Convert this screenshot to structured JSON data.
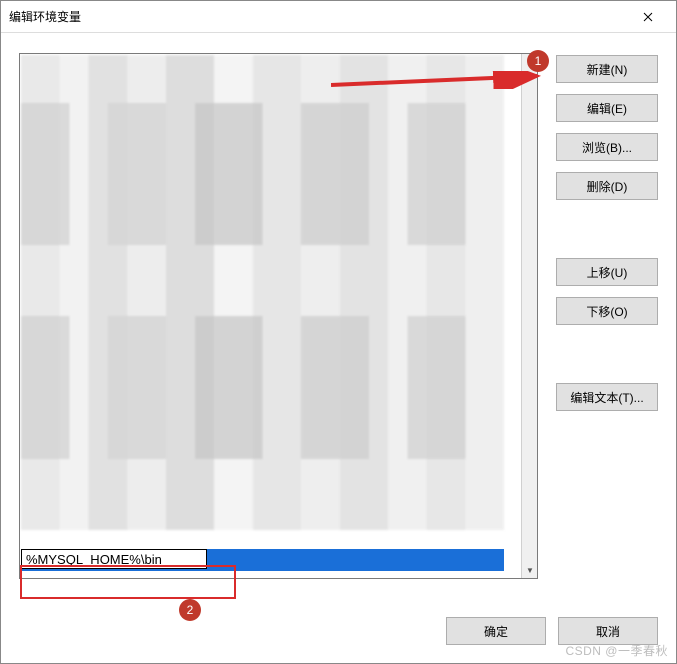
{
  "window": {
    "title": "编辑环境变量"
  },
  "list": {
    "editing_value": "%MYSQL_HOME%\\bin"
  },
  "buttons": {
    "new": "新建(N)",
    "edit": "编辑(E)",
    "browse": "浏览(B)...",
    "delete": "删除(D)",
    "move_up": "上移(U)",
    "move_down": "下移(O)",
    "edit_text": "编辑文本(T)...",
    "ok": "确定",
    "cancel": "取消"
  },
  "annotations": {
    "marker1": "1",
    "marker2": "2"
  },
  "watermark": "CSDN @一季春秋"
}
